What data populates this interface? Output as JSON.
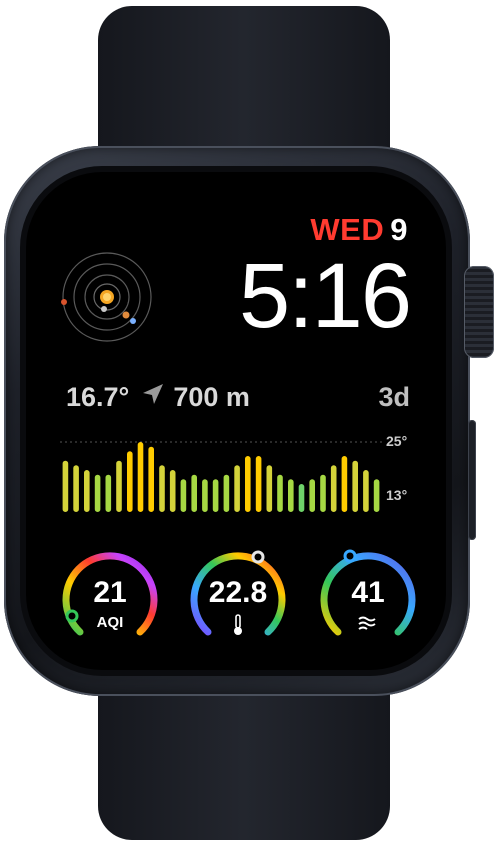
{
  "watch_face": {
    "date": {
      "weekday": "WED",
      "day": "9"
    },
    "time": "5:16",
    "weather": {
      "temperature": "16.7°",
      "distance": "700 m",
      "range": "3d",
      "max_label": "25°",
      "min_label": "13°"
    },
    "complications": [
      {
        "value": "21",
        "label": "AQI",
        "icon": "none"
      },
      {
        "value": "22.8",
        "label": "",
        "icon": "thermometer-icon"
      },
      {
        "value": "41",
        "label": "",
        "icon": "wind-icon"
      }
    ],
    "colors": {
      "accent_red": "#ff3b30",
      "band": "#1e2128",
      "screen": "#000000"
    }
  },
  "chart_data": {
    "type": "bar",
    "title": "",
    "xlabel": "",
    "ylabel": "",
    "ylim": [
      13,
      25
    ],
    "values": [
      21,
      20,
      19,
      18,
      18,
      21,
      23,
      25,
      24,
      20,
      19,
      17,
      18,
      17,
      17,
      18,
      20,
      22,
      22,
      20,
      18,
      17,
      16,
      17,
      18,
      20,
      22,
      21,
      19,
      17
    ],
    "y_tick_labels": [
      "25°",
      "13°"
    ]
  }
}
